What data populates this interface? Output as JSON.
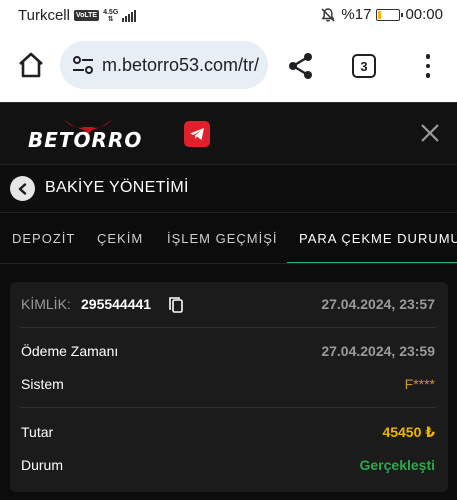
{
  "status_bar": {
    "carrier": "Turkcell",
    "volte": "VoLTE",
    "network": "4.5G",
    "battery_text": "%17",
    "battery_level": 0.17,
    "time": "00:00"
  },
  "browser": {
    "url": "m.betorro53.com/tr/",
    "tab_count": "3"
  },
  "site": {
    "logo_text": "BETORRO",
    "accent": "#e0212b"
  },
  "page": {
    "title": "BAKİYE YÖNETİMİ"
  },
  "tabs": [
    {
      "label": "DEPOZİT",
      "active": false
    },
    {
      "label": "ÇEKİM",
      "active": false
    },
    {
      "label": "İŞLEM GEÇMİŞİ",
      "active": false
    },
    {
      "label": "PARA ÇEKME DURUMU",
      "active": true
    }
  ],
  "transaction": {
    "id_label": "KİMLİK:",
    "id_value": "295544441",
    "created_at": "27.04.2024, 23:57",
    "payment_time_label": "Ödeme Zamanı",
    "payment_time_value": "27.04.2024, 23:59",
    "system_label": "Sistem",
    "system_value": "F****",
    "amount_label": "Tutar",
    "amount_value": "45450 ₺",
    "status_label": "Durum",
    "status_value": "Gerçekleşti"
  },
  "colors": {
    "active_tab_underline": "#2ab27b",
    "amount": "#f0b400",
    "status_success": "#2ea84a",
    "system_value": "#c8952b"
  }
}
